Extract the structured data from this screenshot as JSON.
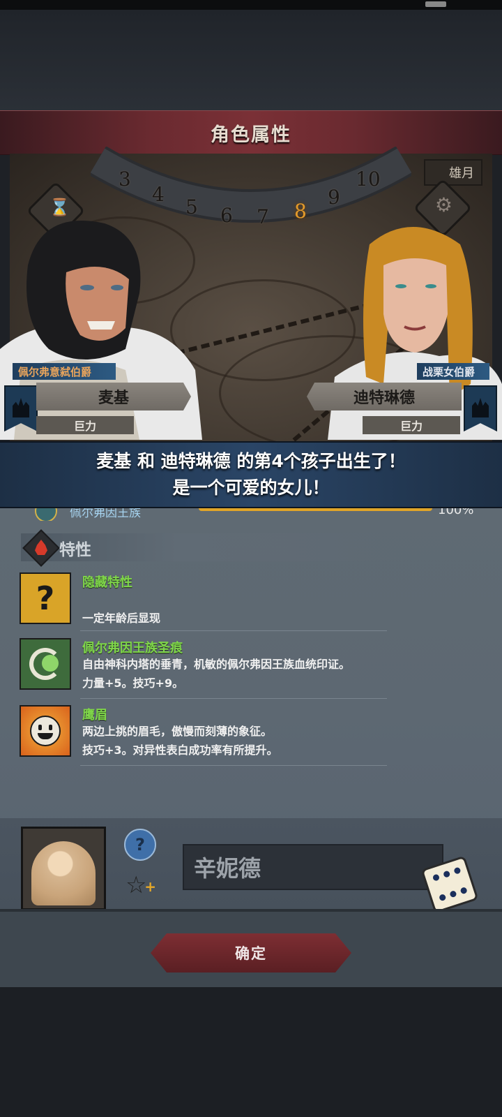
{
  "screen_title": "角色属性",
  "calendar": {
    "numbers": [
      "3",
      "4",
      "5",
      "6",
      "7",
      "8",
      "9",
      "10"
    ],
    "active": "8",
    "month_label": "雄月"
  },
  "father": {
    "title": "佩尔弗意弑伯爵",
    "name": "麦基",
    "trait": "巨力"
  },
  "mother": {
    "title": "战栗女伯爵",
    "name": "迪特琳德",
    "trait": "巨力"
  },
  "announcement": {
    "line1": "麦基 和 迪特琳德 的第4个孩子出生了！",
    "line2": "是一个可爱的女儿！"
  },
  "clan": {
    "name": "佩尔弗因王族",
    "percent_text": "100%",
    "percent": 100
  },
  "traits_section": {
    "label": "特性",
    "items": [
      {
        "name": "隐藏特性",
        "desc1": "",
        "desc2": "一定年龄后显现",
        "icon": "question-mark-icon",
        "color": "#d9a428"
      },
      {
        "name": "佩尔弗因王族圣痕",
        "desc1": "自由神科内塔的垂青，机敏的佩尔弗因王族血统印证。",
        "desc2": "力量+5。技巧+9。",
        "icon": "green-swirl-icon",
        "color": "#6aa84a"
      },
      {
        "name": "鹰眉",
        "desc1": "两边上挑的眉毛，傲慢而刻薄的象征。",
        "desc2": "技巧+3。对异性表白成功率有所提升。",
        "icon": "smiling-face-icon",
        "color": "#e07a20"
      }
    ]
  },
  "child": {
    "name_value": "辛妮德"
  },
  "confirm_label": "确定",
  "colors": {
    "title_bar": "#6a2a30",
    "announce": "#2a4566",
    "trait_name": "#7fd64a",
    "clan_bar": "#e0a528"
  }
}
